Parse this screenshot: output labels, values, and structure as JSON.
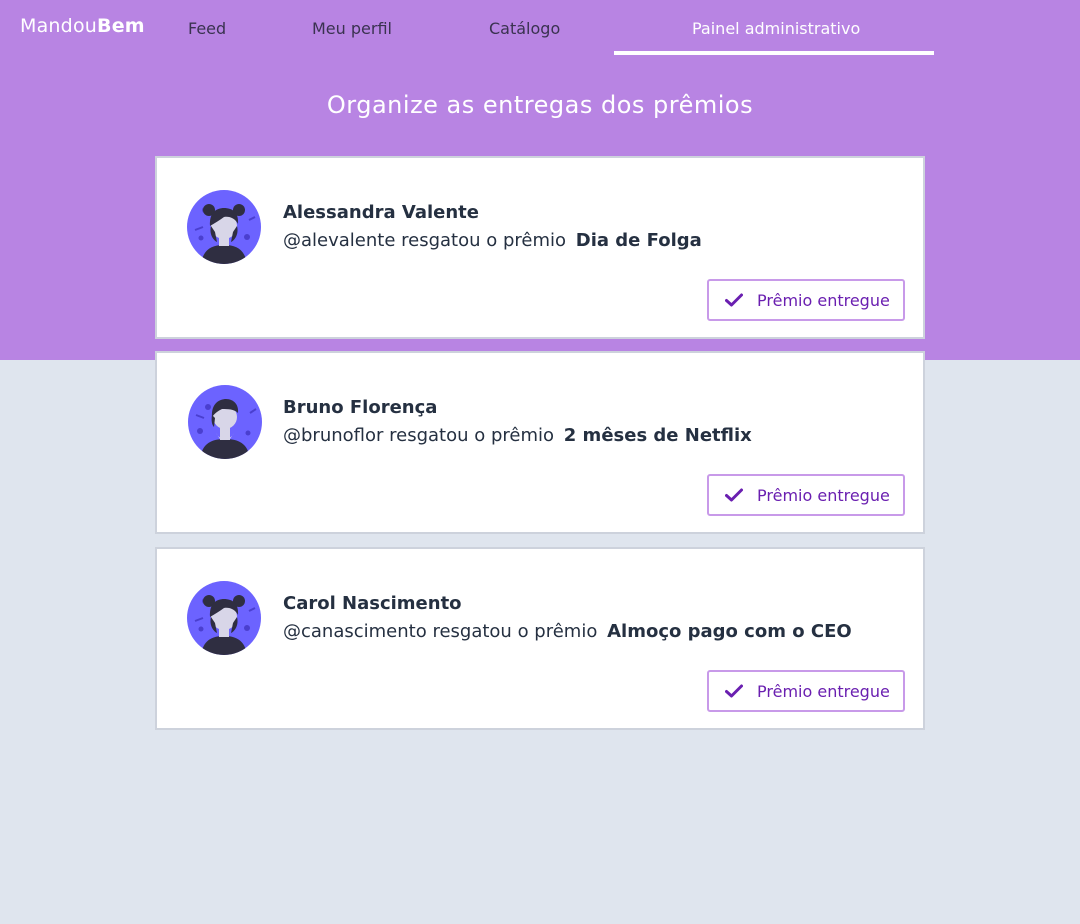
{
  "brand": {
    "light": "Mandou",
    "bold": "Bem"
  },
  "nav": {
    "items": [
      {
        "label": "Feed"
      },
      {
        "label": "Meu perfil"
      },
      {
        "label": "Catálogo"
      },
      {
        "label": "Painel administrativo",
        "active": true
      }
    ]
  },
  "page": {
    "title": "Organize as entregas dos prêmios"
  },
  "rewards": [
    {
      "name": "Alessandra Valente",
      "text": "@alevalente resgatou o prêmio",
      "prize": "Dia de Folga",
      "button_label": "Prêmio entregue",
      "avatar_icon": "female-avatar-icon"
    },
    {
      "name": "Bruno Florença",
      "text": "@brunoflor resgatou o prêmio",
      "prize": "2 mêses de Netflix",
      "button_label": "Prêmio entregue",
      "avatar_icon": "male-avatar-icon"
    },
    {
      "name": "Carol Nascimento",
      "text": "@canascimento resgatou o prêmio",
      "prize": "Almoço pago com o CEO",
      "button_label": "Prêmio entregue",
      "avatar_icon": "female-avatar-icon"
    }
  ],
  "colors": {
    "header_bg": "#b884e3",
    "page_bg": "#dfe5ee",
    "avatar_bg": "#6c63ff",
    "button_text": "#6a1fb0",
    "button_border": "#c89ae9"
  }
}
